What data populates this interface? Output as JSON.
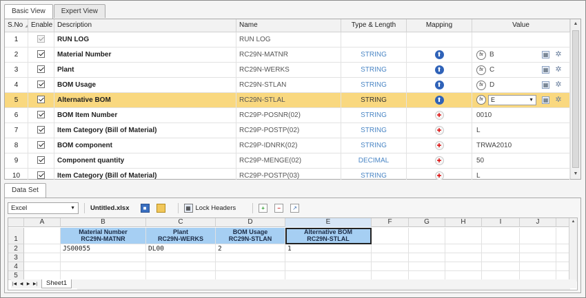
{
  "tabs": {
    "basic": "Basic View",
    "expert": "Expert View"
  },
  "grid": {
    "headers": {
      "sno": "S.No",
      "enable": "Enable",
      "description": "Description",
      "name": "Name",
      "type": "Type & Length",
      "mapping": "Mapping",
      "value": "Value"
    },
    "rows": [
      {
        "sno": "1",
        "description": "RUN LOG",
        "name": "RUN LOG",
        "type": "",
        "mapping": "none",
        "value": ""
      },
      {
        "sno": "2",
        "description": "Material Number",
        "name": "RC29N-MATNR",
        "type": "STRING",
        "mapping": "up-arrow-icon",
        "value": "B"
      },
      {
        "sno": "3",
        "description": "Plant",
        "name": "RC29N-WERKS",
        "type": "STRING",
        "mapping": "up-arrow-icon",
        "value": "C"
      },
      {
        "sno": "4",
        "description": "BOM Usage",
        "name": "RC29N-STLAN",
        "type": "STRING",
        "mapping": "up-arrow-icon",
        "value": "D"
      },
      {
        "sno": "5",
        "description": "Alternative BOM",
        "name": "RC29N-STLAL",
        "type": "STRING",
        "mapping": "up-arrow-icon",
        "value": "E"
      },
      {
        "sno": "6",
        "description": "BOM Item Number",
        "name": "RC29P-POSNR(02)",
        "type": "STRING",
        "mapping": "pin-icon",
        "value": "0010"
      },
      {
        "sno": "7",
        "description": "Item Category (Bill of Material)",
        "name": "RC29P-POSTP(02)",
        "type": "STRING",
        "mapping": "pin-icon",
        "value": "L"
      },
      {
        "sno": "8",
        "description": "BOM component",
        "name": "RC29P-IDNRK(02)",
        "type": "STRING",
        "mapping": "pin-icon",
        "value": "TRWA2010"
      },
      {
        "sno": "9",
        "description": "Component quantity",
        "name": "RC29P-MENGE(02)",
        "type": "DECIMAL",
        "mapping": "pin-icon",
        "value": "50"
      },
      {
        "sno": "10",
        "description": "Item Category (Bill of Material)",
        "name": "RC29P-POSTP(03)",
        "type": "STRING",
        "mapping": "pin-icon",
        "value": "L"
      }
    ]
  },
  "dataset": {
    "tab": "Data Set",
    "source": "Excel",
    "filename": "Untitled.xlsx",
    "lock_headers": "Lock Headers",
    "sheet_tab": "Sheet1",
    "columns": [
      "A",
      "B",
      "C",
      "D",
      "E",
      "F",
      "G",
      "H",
      "I",
      "J"
    ],
    "row_numbers": [
      "1",
      "2",
      "3",
      "4",
      "5"
    ],
    "header_row": [
      {
        "line1": "Material Number",
        "line2": "RC29N-MATNR"
      },
      {
        "line1": "Plant",
        "line2": "RC29N-WERKS"
      },
      {
        "line1": "BOM Usage",
        "line2": "RC29N-STLAN"
      },
      {
        "line1": "Alternative BOM",
        "line2": "RC29N-STLAL"
      }
    ],
    "data_row": [
      "JS00055",
      "DL00",
      "2",
      "1"
    ]
  }
}
